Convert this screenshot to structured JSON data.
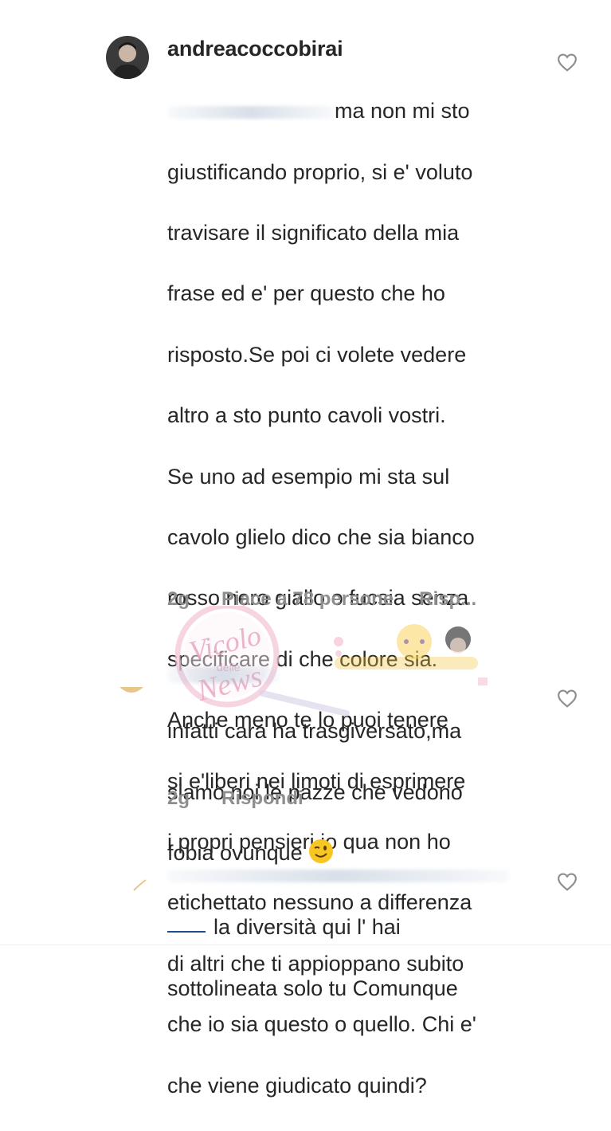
{
  "comments": [
    {
      "username": "andreacoccobirai",
      "text_lines": [
        "ma non mi sto",
        "giustificando proprio, si e' voluto",
        "travisare il significato della mia",
        "frase ed e' per questo che ho",
        "risposto.Se poi ci volete vedere",
        "altro a sto punto cavoli vostri.",
        "Se uno ad esempio mi sta sul",
        "cavolo glielo dico che sia bianco",
        "rosso nero giallo o fucsia senza",
        "specificare di che colore sia.",
        "Anche meno te lo puoi tenere",
        "si e'liberi nei limoti di esprimere",
        "i propri pensieri io qua non ho",
        "etichettato nessuno a differenza",
        "di altri che ti appioppano subito",
        "che io sia questo o quello. Chi e'",
        "che viene giudicato quindi?"
      ],
      "time": "2g",
      "likes": "Piace a 78 persone",
      "reply": "Risp..."
    },
    {
      "text_lines": [
        "infatti cara ha trasgiversato,ma",
        "siamo noi le pazze che vedono",
        "fobia ovunque"
      ],
      "time": "2g",
      "reply": "Rispondi"
    },
    {
      "text_lines": [
        "la diversità qui l' hai",
        "sottolineata solo tu Comunque"
      ]
    }
  ],
  "watermark": {
    "line1": "Vicolo",
    "line2": "delle",
    "line3": "News"
  },
  "colors": {
    "text": "#262626",
    "meta": "#8e8e8e",
    "watermark_pink": "#e9a9c4"
  }
}
